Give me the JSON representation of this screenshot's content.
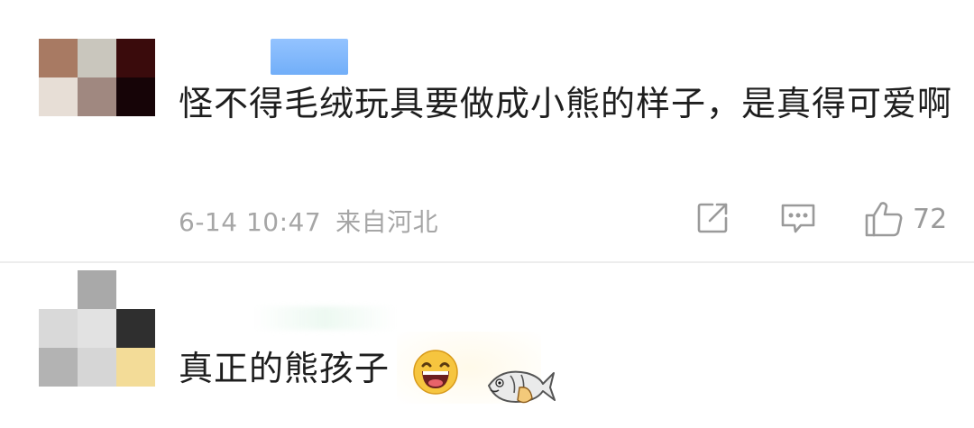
{
  "comments": [
    {
      "avatar_pixels": [
        "#a87a63",
        "#c9c6bd",
        "#3a0b0c",
        "#e7ded6",
        "#a08880",
        "#160407"
      ],
      "text": "怪不得毛绒玩具要做成小熊的样子，是真得可爱啊",
      "date": "6-14 10:47",
      "location": "来自河北",
      "like_count": "72"
    },
    {
      "avatar_pixels": [
        "#ffffff",
        "#a9a9a9",
        "#ffffff",
        "#d9d9d9",
        "#e2e2e2",
        "#2f2f2f",
        "#b3b3b3",
        "#d6d6d6",
        "#f3dc98"
      ],
      "text": "真正的熊孩子"
    }
  ],
  "icons": {
    "share": "share-icon",
    "comment": "comment-icon",
    "like": "thumbs-up-icon",
    "emoji": "laughing-face-emoji-icon",
    "sticker": "fish-sticker-icon"
  },
  "colors": {
    "text": "#1e1e1e",
    "meta": "#a6a6a6",
    "icon": "#9a9a9a",
    "divider": "#ededed"
  }
}
